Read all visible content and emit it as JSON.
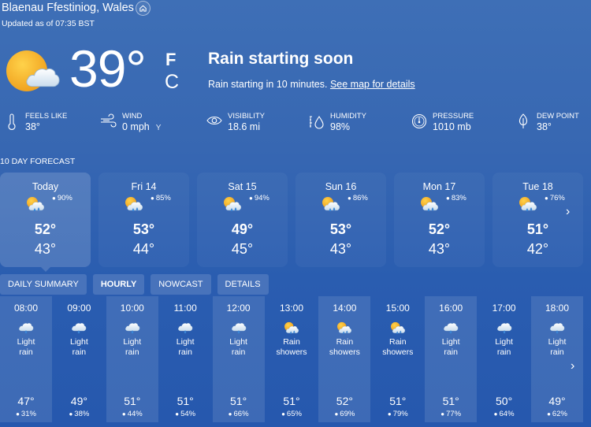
{
  "header": {
    "location": "Blaenau Ffestiniog, Wales",
    "updated": "Updated as of 07:35 BST",
    "home_icon": "home-icon"
  },
  "current": {
    "temperature": "39°",
    "unit_f": "F",
    "unit_c": "C",
    "icon": "partly-cloudy-icon",
    "headline": "Rain starting soon",
    "subline": "Rain starting in 10 minutes.",
    "map_link": "See map for details"
  },
  "stats": [
    {
      "label": "Feels Like",
      "value": "38°",
      "icon": "thermometer-icon"
    },
    {
      "label": "Wind",
      "value": "0 mph",
      "icon": "wind-icon",
      "direction": "Y"
    },
    {
      "label": "Visibility",
      "value": "18.6 mi",
      "icon": "eye-icon"
    },
    {
      "label": "Humidity",
      "value": "98%",
      "icon": "humidity-icon"
    },
    {
      "label": "Pressure",
      "value": "1010 mb",
      "icon": "gauge-icon"
    },
    {
      "label": "Dew Point",
      "value": "38°",
      "icon": "dew-point-icon"
    }
  ],
  "forecast": {
    "title": "10 Day Forecast",
    "days": [
      {
        "name": "Today",
        "precip": "90%",
        "high": "52°",
        "low": "43°",
        "icon": "rain-showers-icon",
        "active": true
      },
      {
        "name": "Fri 14",
        "precip": "85%",
        "high": "53°",
        "low": "44°",
        "icon": "rain-showers-icon"
      },
      {
        "name": "Sat 15",
        "precip": "94%",
        "high": "49°",
        "low": "45°",
        "icon": "rain-showers-icon"
      },
      {
        "name": "Sun 16",
        "precip": "86%",
        "high": "53°",
        "low": "43°",
        "icon": "rain-showers-icon"
      },
      {
        "name": "Mon 17",
        "precip": "83%",
        "high": "52°",
        "low": "43°",
        "icon": "rain-showers-icon"
      },
      {
        "name": "Tue 18",
        "precip": "76%",
        "high": "51°",
        "low": "42°",
        "icon": "rain-showers-icon"
      }
    ],
    "next_icon": "chevron-right-icon"
  },
  "tabs": [
    {
      "label": "Daily Summary"
    },
    {
      "label": "Hourly",
      "active": true
    },
    {
      "label": "Nowcast"
    },
    {
      "label": "Details"
    }
  ],
  "hourly": [
    {
      "time": "08:00",
      "cond1": "Light",
      "cond2": "rain",
      "temp": "47°",
      "precip": "31%",
      "icon": "light-rain-icon"
    },
    {
      "time": "09:00",
      "cond1": "Light",
      "cond2": "rain",
      "temp": "49°",
      "precip": "38%",
      "icon": "light-rain-icon"
    },
    {
      "time": "10:00",
      "cond1": "Light",
      "cond2": "rain",
      "temp": "51°",
      "precip": "44%",
      "icon": "light-rain-icon"
    },
    {
      "time": "11:00",
      "cond1": "Light",
      "cond2": "rain",
      "temp": "51°",
      "precip": "54%",
      "icon": "light-rain-icon"
    },
    {
      "time": "12:00",
      "cond1": "Light",
      "cond2": "rain",
      "temp": "51°",
      "precip": "66%",
      "icon": "light-rain-icon"
    },
    {
      "time": "13:00",
      "cond1": "Rain",
      "cond2": "showers",
      "temp": "51°",
      "precip": "65%",
      "icon": "rain-showers-icon"
    },
    {
      "time": "14:00",
      "cond1": "Rain",
      "cond2": "showers",
      "temp": "52°",
      "precip": "69%",
      "icon": "rain-showers-icon"
    },
    {
      "time": "15:00",
      "cond1": "Rain",
      "cond2": "showers",
      "temp": "51°",
      "precip": "79%",
      "icon": "rain-showers-icon"
    },
    {
      "time": "16:00",
      "cond1": "Light",
      "cond2": "rain",
      "temp": "51°",
      "precip": "77%",
      "icon": "light-rain-icon"
    },
    {
      "time": "17:00",
      "cond1": "Light",
      "cond2": "rain",
      "temp": "50°",
      "precip": "64%",
      "icon": "light-rain-icon"
    },
    {
      "time": "18:00",
      "cond1": "Light",
      "cond2": "rain",
      "temp": "49°",
      "precip": "62%",
      "icon": "light-rain-icon"
    }
  ],
  "colors": {
    "sun": "#f5b52a",
    "cloud": "#e8f1f8",
    "rain": "#4a90d9"
  }
}
